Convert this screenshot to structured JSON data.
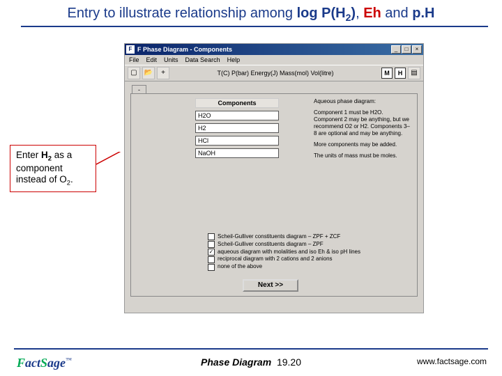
{
  "title": {
    "pre": "Entry to illustrate relationship among ",
    "b1": "log P(H",
    "b1sub": "2",
    "b1end": ")",
    "mid": ", ",
    "hl": "Eh",
    "post1": " and ",
    "b2": "p.H"
  },
  "callout": {
    "l1a": "Enter ",
    "l1b": "H",
    "l1sub": "2",
    "l2": " as a component instead of O",
    "l2sub": "2",
    "l2end": "."
  },
  "app": {
    "windowTitle": "F Phase Diagram - Components",
    "menu": [
      "File",
      "Edit",
      "Units",
      "Data Search",
      "Help"
    ],
    "toolbarCaption": "T(C) P(bar) Energy(J) Mass(mol) Vol(litre)",
    "toolbarBadge1": "M",
    "toolbarBadge2": "H",
    "tab": "-",
    "componentsHeader": "Components",
    "components": [
      "H2O",
      "H2",
      "HCl",
      "NaOH"
    ],
    "info": {
      "heading": "Aqueous phase diagram:",
      "p1": "Component 1 must be H2O. Component 2 may be anything, but we recommend O2 or H2. Components 3–8 are optional and may be anything.",
      "p2": "More components may be added.",
      "p3": "The units of mass must be moles."
    },
    "options": [
      {
        "label": "Scheil-Gulliver constituents diagram – ZPF + ZCF",
        "checked": false
      },
      {
        "label": "Scheil-Gulliver constituents diagram – ZPF",
        "checked": false
      },
      {
        "label": "aqueous diagram with molalities and iso Eh & iso pH lines",
        "checked": true
      },
      {
        "label": "reciprocal diagram with 2 cations and 2 anions",
        "checked": false
      },
      {
        "label": "none of the above",
        "checked": false
      }
    ],
    "next": "Next >>"
  },
  "footer": {
    "module": "Phase Diagram",
    "page": "19.20",
    "url": "www.factsage.com"
  }
}
